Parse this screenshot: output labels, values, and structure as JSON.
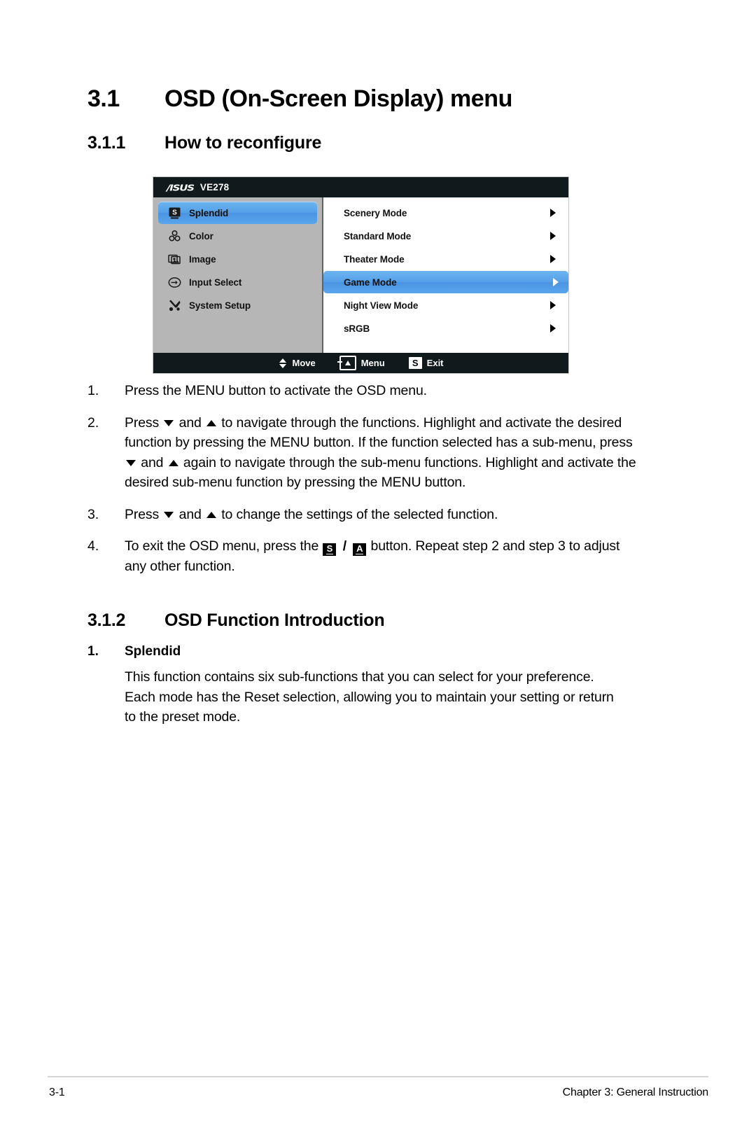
{
  "document": {
    "section": {
      "number": "3.1",
      "title": "OSD (On-Screen Display) menu"
    },
    "subsection_1": {
      "number": "3.1.1",
      "title": "How to reconfigure"
    },
    "subsection_2": {
      "number": "3.1.2",
      "title": "OSD Function Introduction"
    }
  },
  "osd": {
    "brand": "/ISUS",
    "model": "VE278",
    "menu_items": [
      {
        "icon": "splendid-icon",
        "label": "Splendid",
        "selected": true
      },
      {
        "icon": "color-icon",
        "label": "Color",
        "selected": false
      },
      {
        "icon": "image-icon",
        "label": "Image",
        "selected": false
      },
      {
        "icon": "input-select-icon",
        "label": "Input Select",
        "selected": false
      },
      {
        "icon": "system-setup-icon",
        "label": "System Setup",
        "selected": false
      }
    ],
    "submenu_items": [
      {
        "label": "Scenery Mode",
        "selected": false
      },
      {
        "label": "Standard Mode",
        "selected": false
      },
      {
        "label": "Theater Mode",
        "selected": false
      },
      {
        "label": "Game Mode",
        "selected": true
      },
      {
        "label": "Night View Mode",
        "selected": false
      },
      {
        "label": "sRGB",
        "selected": false
      }
    ],
    "footer_buttons": [
      {
        "icon": "up-down-arrow-icon",
        "label": "Move"
      },
      {
        "icon": "menu-key-icon",
        "label": "Menu"
      },
      {
        "icon": "splendid-key-icon",
        "label": "Exit"
      }
    ],
    "colors": {
      "titlebar": "#101a1c",
      "sidebar": "#b6b6b6",
      "highlight": "#55a0e8",
      "panel": "#ffffff"
    }
  },
  "steps": [
    {
      "number": "1.",
      "parts": [
        {
          "type": "text",
          "value": "Press the MENU button to activate the OSD menu."
        }
      ]
    },
    {
      "number": "2.",
      "parts": [
        {
          "type": "text",
          "value": "Press "
        },
        {
          "type": "icon",
          "value": "triangle-down-icon"
        },
        {
          "type": "text",
          "value": " and "
        },
        {
          "type": "icon",
          "value": "triangle-up-icon"
        },
        {
          "type": "text",
          "value": " to navigate through the functions. Highlight and activate the desired function by pressing the MENU button. If the function selected has a sub-menu, press "
        },
        {
          "type": "icon",
          "value": "triangle-down-icon"
        },
        {
          "type": "text",
          "value": " and "
        },
        {
          "type": "icon",
          "value": "triangle-up-icon"
        },
        {
          "type": "text",
          "value": " again to navigate through the sub-menu functions. Highlight and activate the desired sub-menu function by pressing the MENU button."
        }
      ]
    },
    {
      "number": "3.",
      "parts": [
        {
          "type": "text",
          "value": "Press "
        },
        {
          "type": "icon",
          "value": "triangle-down-icon"
        },
        {
          "type": "text",
          "value": " and "
        },
        {
          "type": "icon",
          "value": "triangle-up-icon"
        },
        {
          "type": "text",
          "value": " to change the settings of the selected function."
        }
      ]
    },
    {
      "number": "4.",
      "parts": [
        {
          "type": "text",
          "value": "To exit the OSD menu, press the "
        },
        {
          "type": "keycap",
          "value": "S"
        },
        {
          "type": "text",
          "value": " / "
        },
        {
          "type": "keycap",
          "value": "A"
        },
        {
          "type": "text",
          "value": " button. Repeat step 2 and step 3 to adjust any other function."
        }
      ]
    }
  ],
  "splendid": {
    "number": "1.",
    "title": "Splendid",
    "paragraph": "This function contains six sub-functions that you can select for your preference. Each mode has the Reset selection, allowing you to maintain your setting or return to the preset mode."
  },
  "page_footer": {
    "page_number": "3-1",
    "chapter": "Chapter 3: General Instruction"
  }
}
